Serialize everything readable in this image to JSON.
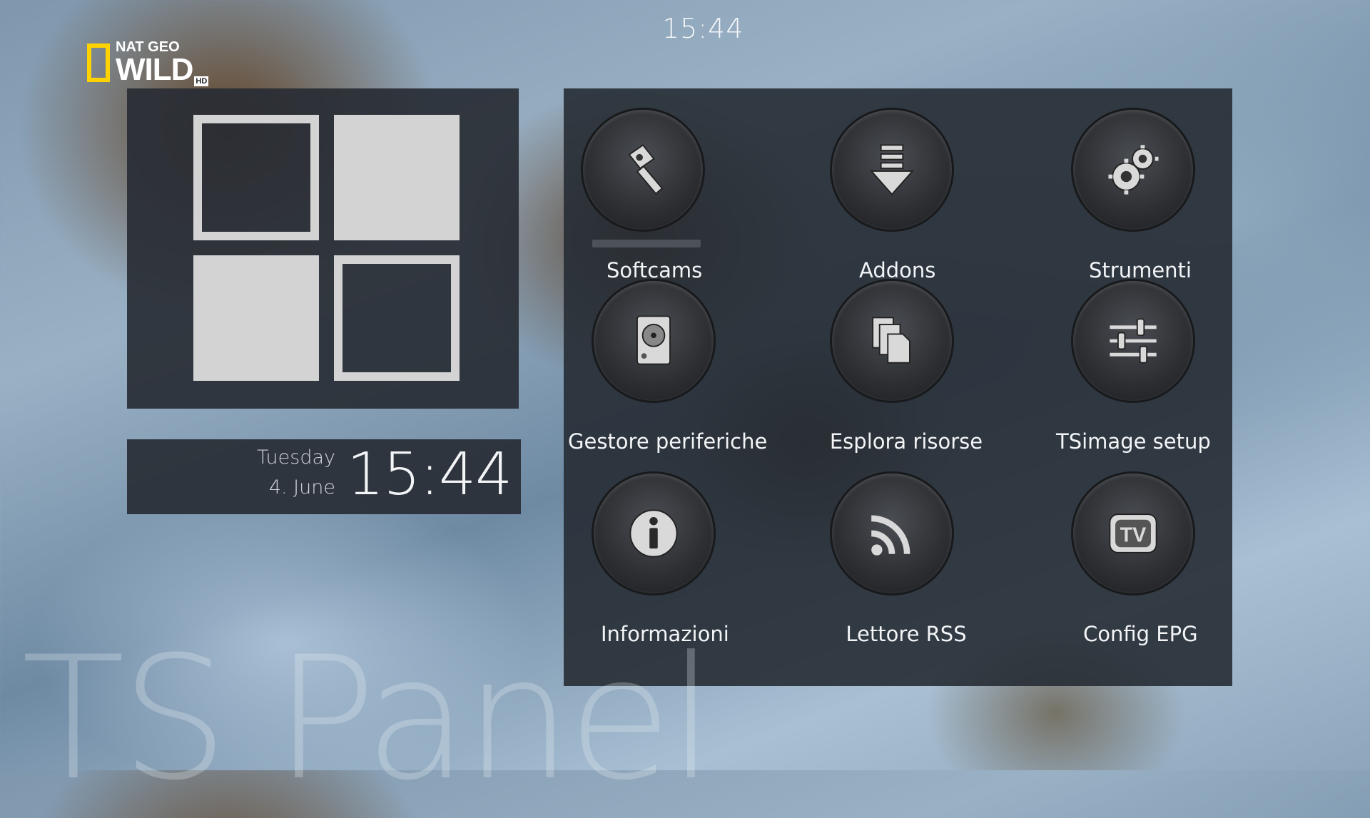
{
  "clock": {
    "time": "15:44"
  },
  "channel_logo": {
    "top": "NAT GEO",
    "main": "WILD",
    "badge": "HD"
  },
  "datetime": {
    "day": "Tuesday",
    "date": "4. June",
    "time": "15:44"
  },
  "menu": {
    "selected_index": 0,
    "items": [
      {
        "label": "Softcams",
        "icon": "key-icon"
      },
      {
        "label": "Addons",
        "icon": "download-icon"
      },
      {
        "label": "Strumenti",
        "icon": "gears-icon"
      },
      {
        "label": "Gestore periferiche",
        "icon": "harddisk-icon"
      },
      {
        "label": "Esplora risorse",
        "icon": "files-icon"
      },
      {
        "label": "TSimage setup",
        "icon": "sliders-icon"
      },
      {
        "label": "Informazioni",
        "icon": "info-icon"
      },
      {
        "label": "Lettore RSS",
        "icon": "rss-icon"
      },
      {
        "label": "Config EPG",
        "icon": "tv-icon"
      }
    ]
  },
  "watermark": {
    "text": "TS Panel"
  },
  "colors": {
    "panel": "#282d34",
    "tile": "#d3d3d3",
    "logo_yellow": "#ffd200"
  }
}
